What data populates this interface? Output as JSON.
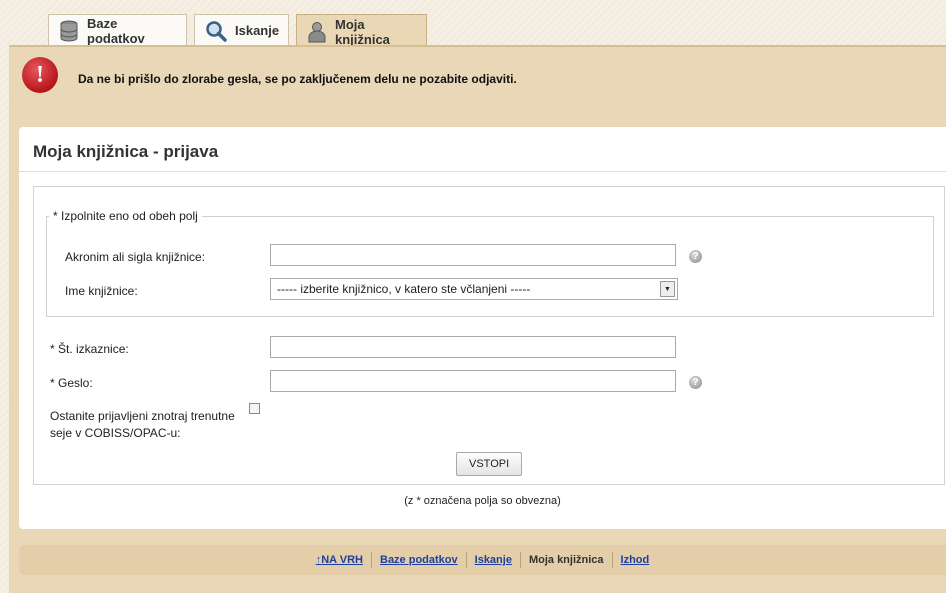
{
  "tabs": [
    {
      "label": "Baze podatkov",
      "icon": "database-icon"
    },
    {
      "label": "Iskanje",
      "icon": "magnifier-icon"
    },
    {
      "label": "Moja knjižnica",
      "icon": "user-icon",
      "active": true
    }
  ],
  "alert": {
    "icon": "exclamation-icon",
    "symbol": "!",
    "text": "Da ne bi prišlo do zlorabe gesla, se po zaključenem delu ne pozabite odjaviti."
  },
  "panel": {
    "title": "Moja knjižnica - prijava"
  },
  "form": {
    "group_legend": "* Izpolnite eno od obeh polj",
    "acronym_label": "Akronim ali sigla knjižnice:",
    "acronym_value": "",
    "library_label": "Ime knjižnice:",
    "library_selected": "----- izberite knjižnico, v katero ste včlanjeni -----",
    "card_label": "* Št. izkaznice:",
    "card_value": "",
    "password_label": "* Geslo:",
    "password_value": "",
    "stay_label": "Ostanite prijavljeni znotraj trenutne seje v COBISS/OPAC-u:",
    "stay_checked": false,
    "submit_label": "VSTOPI",
    "help_symbol": "?",
    "required_note": "(z * označena polja so obvezna)"
  },
  "footer": {
    "top_arrow": "↑",
    "top_label": "NA VRH",
    "links": [
      "Baze podatkov",
      "Iskanje"
    ],
    "current": "Moja knjižnica",
    "logout": "Izhod"
  },
  "colors": {
    "band": "#ead7b7",
    "alert_red": "#c0181e",
    "link": "#1f3f9f"
  }
}
